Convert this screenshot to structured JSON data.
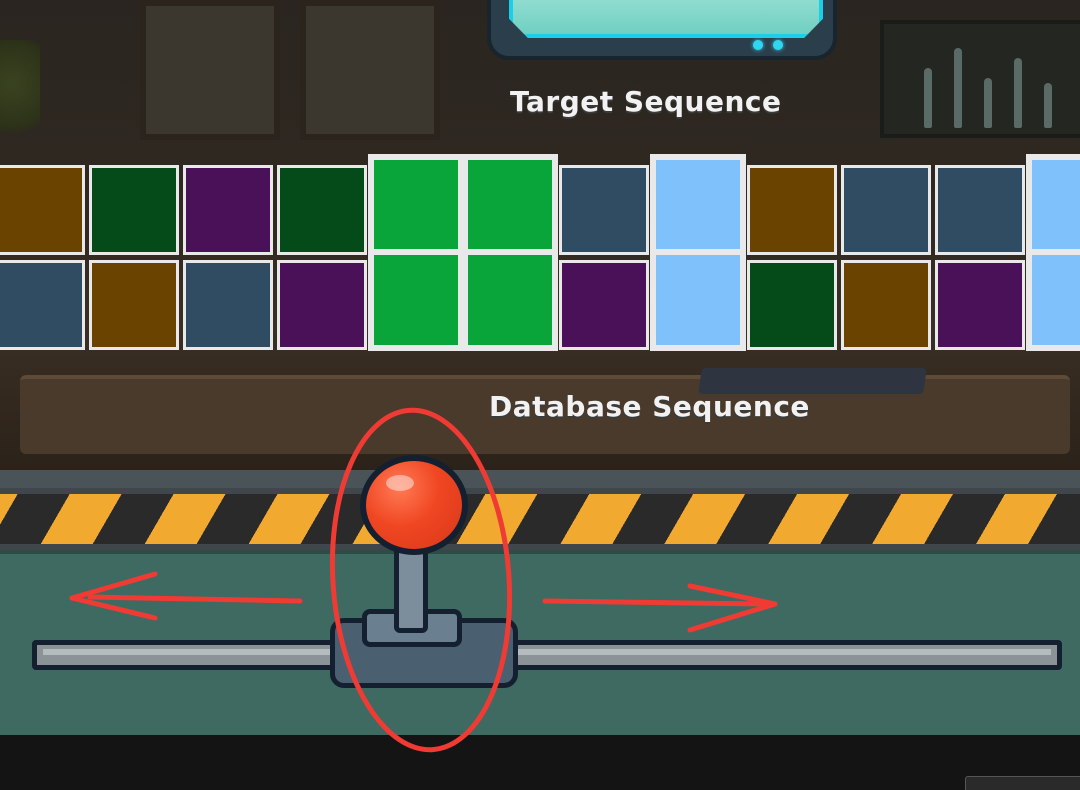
{
  "labels": {
    "target": "Target Sequence",
    "database": "Database Sequence"
  },
  "colors": {
    "brown": "#6b4300",
    "darkgreen": "#054b1a",
    "purple": "#4a1158",
    "slate": "#2f4c63",
    "green": "#0aa53a",
    "lightblue": "#7fc2fb",
    "hazard_yellow": "#f1a930",
    "knob_red": "#f04622",
    "panel": "#3e6a61",
    "annotation": "#ef3b33"
  },
  "target_sequence": [
    "brown",
    "darkgreen",
    "purple",
    "darkgreen",
    "green",
    "green",
    "slate",
    "lightblue",
    "brown",
    "slate",
    "slate",
    "lightblue"
  ],
  "database_sequence": [
    "slate",
    "brown",
    "slate",
    "purple",
    "green",
    "green",
    "purple",
    "lightblue",
    "darkgreen",
    "brown",
    "purple",
    "lightblue"
  ],
  "highlighted_target_columns": [
    4,
    5,
    7,
    11
  ],
  "highlighted_database_columns": [
    4,
    5,
    7,
    11
  ],
  "controls": {
    "lever": "slider-lever",
    "icons": [
      "arrow-left-icon",
      "arrow-right-icon"
    ]
  }
}
